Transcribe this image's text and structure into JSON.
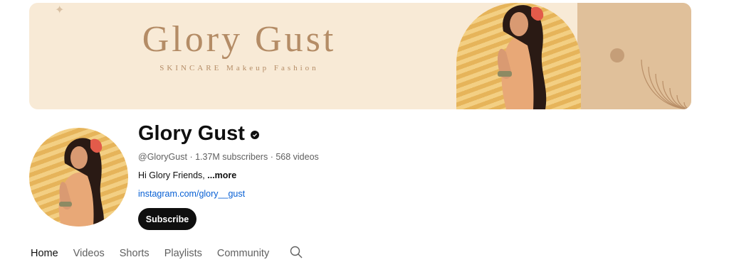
{
  "banner": {
    "title": "Glory Gust",
    "subtitle": "SKINCARE Makeup Fashion"
  },
  "channel": {
    "name": "Glory Gust",
    "handle": "@GloryGust",
    "subscribers": "1.37M subscribers",
    "videos": "568 videos",
    "description": "Hi Glory Friends,",
    "more_label": "...more",
    "link": "instagram.com/glory__gust",
    "subscribe_label": "Subscribe"
  },
  "tabs": [
    {
      "label": "Home",
      "active": true
    },
    {
      "label": "Videos"
    },
    {
      "label": "Shorts"
    },
    {
      "label": "Playlists"
    },
    {
      "label": "Community"
    }
  ],
  "icons": {
    "verified": "verified-check-icon",
    "search": "search-icon"
  },
  "colors": {
    "banner_bg": "#f8ead6",
    "banner_text": "#b48c66",
    "link": "#065fd4",
    "subscribe_bg": "#0f0f0f"
  }
}
